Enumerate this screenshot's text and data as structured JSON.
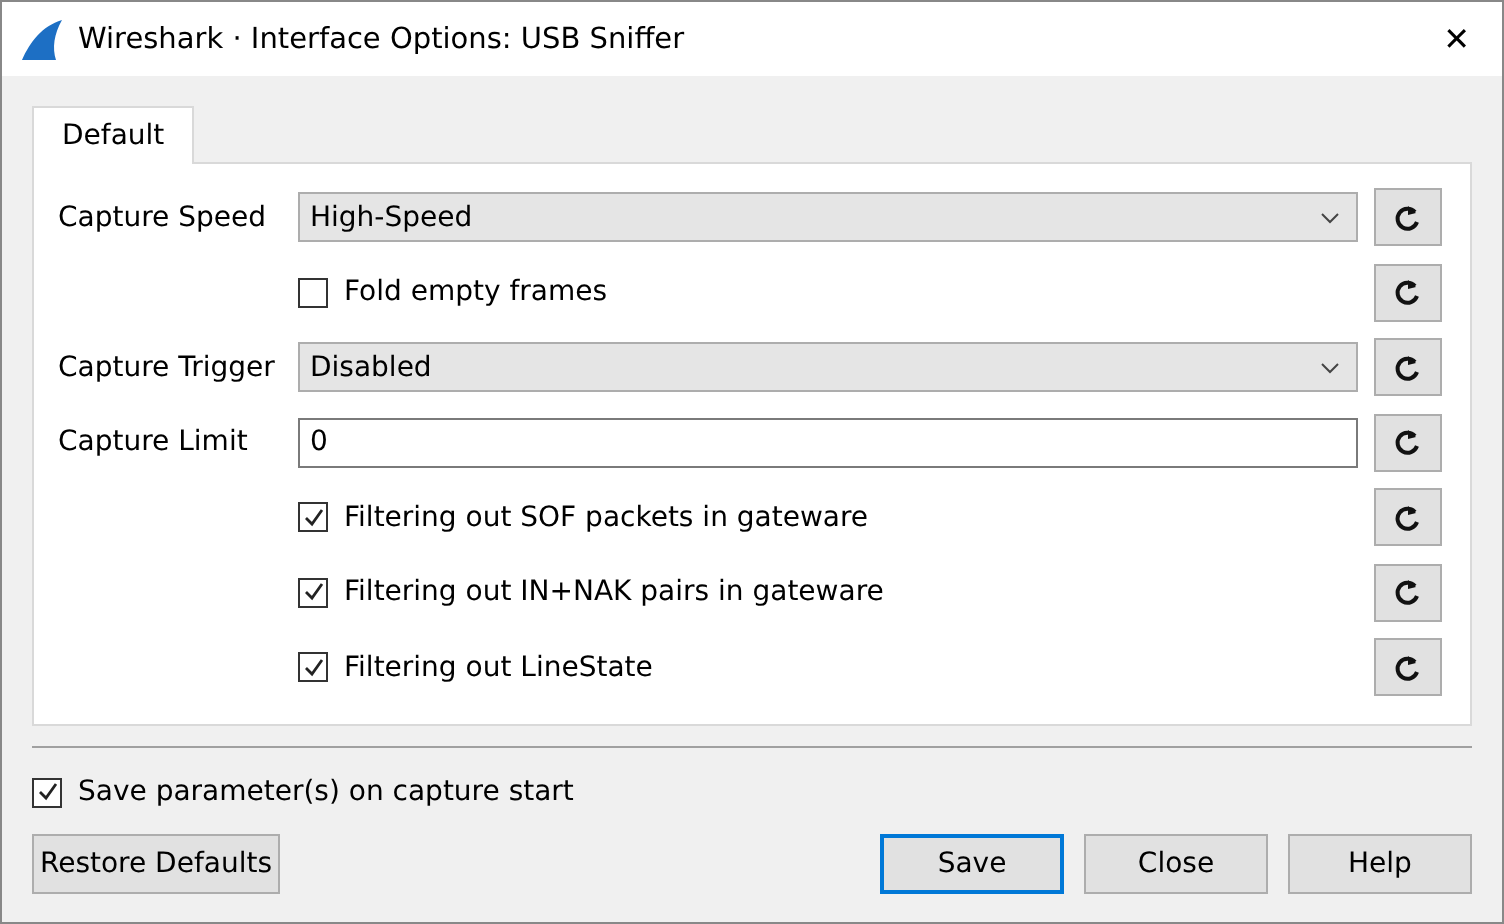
{
  "window": {
    "title": "Wireshark · Interface Options: USB Sniffer",
    "close": "✕"
  },
  "tabs": [
    {
      "label": "Default",
      "selected": true
    }
  ],
  "rows": [
    {
      "kind": "select",
      "label": "Capture Speed",
      "value": "High-Speed"
    },
    {
      "kind": "checkbox",
      "label": "Fold empty frames",
      "checked": false
    },
    {
      "kind": "select",
      "label": "Capture Trigger",
      "value": "Disabled"
    },
    {
      "kind": "text",
      "label": "Capture Limit",
      "value": "0"
    },
    {
      "kind": "checkbox",
      "label": "Filtering out SOF packets in gateware",
      "checked": true
    },
    {
      "kind": "checkbox",
      "label": "Filtering out IN+NAK pairs in gateware",
      "checked": true
    },
    {
      "kind": "checkbox",
      "label": "Filtering out LineState",
      "checked": true
    }
  ],
  "save_on_start": {
    "label": "Save parameter(s) on capture start",
    "checked": true
  },
  "buttons": [
    {
      "label": "Restore Defaults",
      "default": false
    },
    {
      "label": "Save",
      "default": true
    },
    {
      "label": "Close",
      "default": false
    },
    {
      "label": "Help",
      "default": false
    }
  ]
}
